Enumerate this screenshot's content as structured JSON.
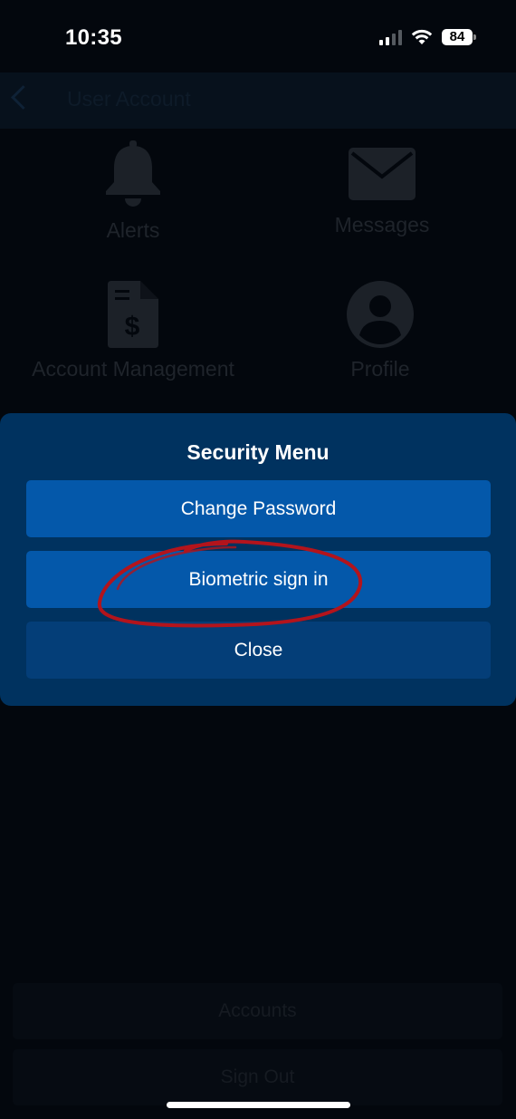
{
  "status_bar": {
    "time": "10:35",
    "battery": "84",
    "icons": [
      "signal-icon",
      "wifi-icon",
      "battery-icon"
    ]
  },
  "header": {
    "title": "User Account"
  },
  "grid": [
    {
      "label": "Alerts",
      "icon": "bell-icon"
    },
    {
      "label": "Messages",
      "icon": "envelope-icon"
    },
    {
      "label": "Account Management",
      "icon": "dollar-document-icon"
    },
    {
      "label": "Profile",
      "icon": "user-circle-icon"
    }
  ],
  "security_menu": {
    "title": "Security Menu",
    "buttons": [
      {
        "label": "Change Password"
      },
      {
        "label": "Biometric sign in"
      },
      {
        "label": "Close"
      }
    ]
  },
  "bottom_buttons": [
    {
      "label": "Accounts"
    },
    {
      "label": "Sign Out"
    }
  ],
  "colors": {
    "sheet_bg": "#00325f",
    "button_bg": "#0458aa",
    "close_bg": "#043e78",
    "annotation": "#b3141c"
  }
}
